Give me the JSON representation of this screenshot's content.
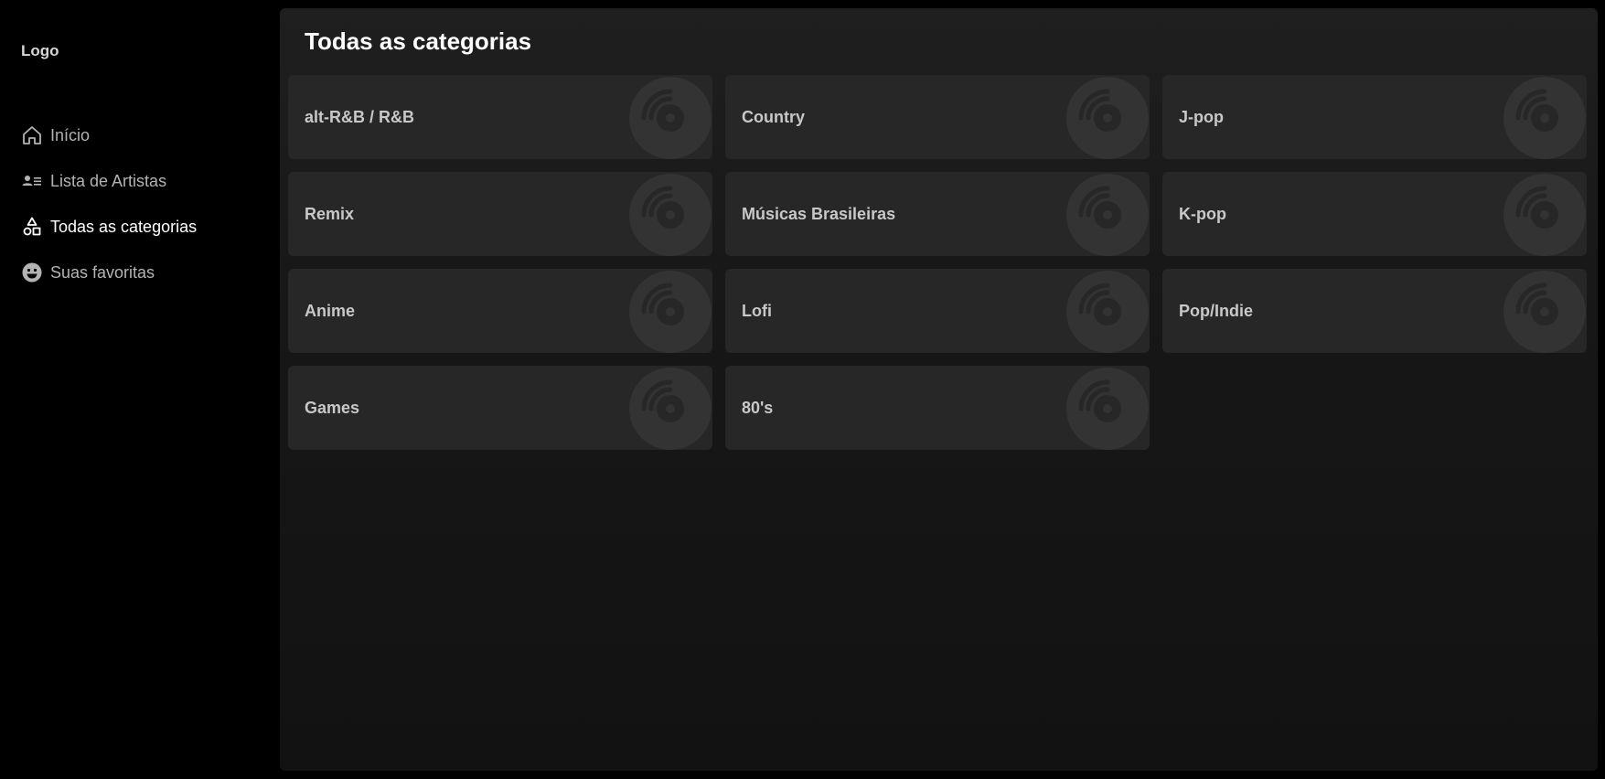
{
  "sidebar": {
    "logo": "Logo",
    "items": [
      {
        "label": "Início",
        "icon": "home-icon",
        "active": false
      },
      {
        "label": "Lista de Artistas",
        "icon": "artist-list-icon",
        "active": false
      },
      {
        "label": "Todas as categorias",
        "icon": "categories-icon",
        "active": true
      },
      {
        "label": "Suas favoritas",
        "icon": "smiley-icon",
        "active": false
      }
    ]
  },
  "main": {
    "title": "Todas as categorias",
    "categories": [
      {
        "label": "alt-R&B / R&B",
        "icon": "vinyl-disc-icon"
      },
      {
        "label": "Country",
        "icon": "vinyl-disc-icon"
      },
      {
        "label": "J-pop",
        "icon": "vinyl-disc-icon"
      },
      {
        "label": "Remix",
        "icon": "vinyl-disc-icon"
      },
      {
        "label": "Músicas Brasileiras",
        "icon": "vinyl-disc-icon"
      },
      {
        "label": "K-pop",
        "icon": "vinyl-disc-icon"
      },
      {
        "label": "Anime",
        "icon": "vinyl-disc-icon"
      },
      {
        "label": "Lofi",
        "icon": "vinyl-disc-icon"
      },
      {
        "label": "Pop/Indie",
        "icon": "vinyl-disc-icon"
      },
      {
        "label": "Games",
        "icon": "vinyl-disc-icon"
      },
      {
        "label": "80's",
        "icon": "vinyl-disc-icon"
      }
    ]
  },
  "colors": {
    "background": "#000000",
    "panel": "#1f1f1f",
    "card": "#272727",
    "disc": "#333333",
    "text_active": "#ffffff",
    "text_muted": "#b3b3b3"
  }
}
